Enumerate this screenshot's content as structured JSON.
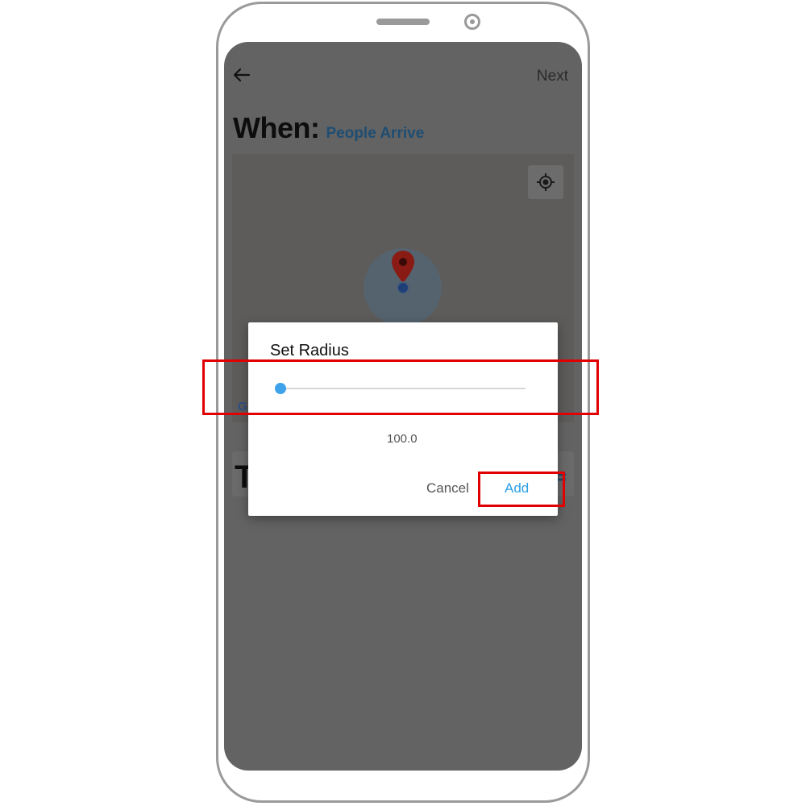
{
  "header": {
    "back_icon": "arrow-left-icon",
    "next_label": "Next"
  },
  "trigger": {
    "label": "When:",
    "value": "People Arrive"
  },
  "map": {
    "locate_icon": "crosshair-icon",
    "pin_icon": "map-pin-icon",
    "attribution_fragment": "G"
  },
  "second_section": {
    "title_fragment": "T"
  },
  "dialog": {
    "title": "Set Radius",
    "slider_value": "100.0",
    "slider_fraction": 0.0,
    "cancel_label": "Cancel",
    "add_label": "Add"
  },
  "colors": {
    "accent": "#2aa0e8",
    "overlay": "#636363",
    "highlight": "#e00000",
    "pin": "#8a1a14"
  }
}
